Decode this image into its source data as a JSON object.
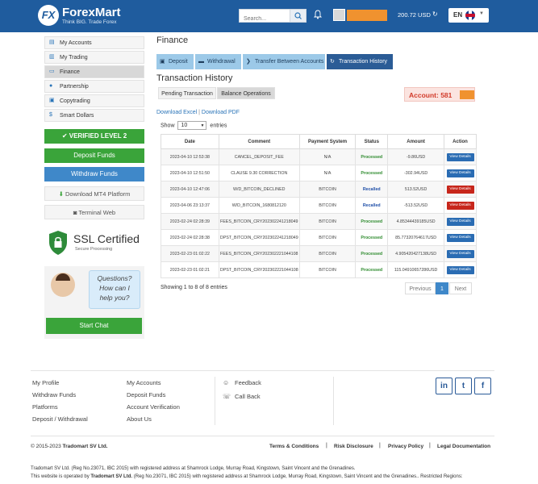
{
  "header": {
    "logo_name": "ForexMart",
    "logo_tagline": "Think BIG. Trade Forex",
    "search_placeholder": "Search...",
    "balance": "200.72 USD",
    "lang": "EN"
  },
  "sidebar": {
    "items": [
      {
        "label": "My Accounts",
        "icon": "document-icon"
      },
      {
        "label": "My Trading",
        "icon": "chart-icon"
      },
      {
        "label": "Finance",
        "icon": "card-icon"
      },
      {
        "label": "Partnership",
        "icon": "people-icon"
      },
      {
        "label": "Copytrading",
        "icon": "copy-icon"
      },
      {
        "label": "Smart Dollars",
        "icon": "dollar-icon"
      }
    ],
    "verified": "VERIFIED LEVEL 2",
    "deposit": "Deposit Funds",
    "withdraw": "Withdraw Funds",
    "mt4": "Download MT4 Platform",
    "terminal": "Terminal Web",
    "ssl_title": "SSL Certified",
    "ssl_sub": "Secure Processing",
    "chat_bubble": [
      "Questions?",
      "How can I",
      "help you?"
    ],
    "chat_button": "Start Chat"
  },
  "main": {
    "title": "Finance",
    "tabs": [
      "Deposit",
      "Withdrawal",
      "Transfer Between Accounts",
      "Transaction History"
    ],
    "section_title": "Transaction History",
    "subtabs": [
      "Pending Transaction",
      "Balance Operations"
    ],
    "account_label": "Account: 581",
    "download_excel": "Download Excel",
    "download_pdf": "Download PDF",
    "show_label": "Show",
    "show_value": "10",
    "entries_label": "entries",
    "table": {
      "headers": [
        "Date",
        "Comment",
        "Payment System",
        "Status",
        "Amount",
        "Action"
      ],
      "rows": [
        {
          "date": "2023-04-10 12:53:38",
          "comment": "CANCEL_DEPOSIT_FEE",
          "payment": "N/A",
          "status": "Processed",
          "amount": "-9.86USD",
          "action": "View Details",
          "action_color": "blue"
        },
        {
          "date": "2023-04-10 12:51:50",
          "comment": "CLAUSE 9.30 CORRECTION",
          "payment": "N/A",
          "status": "Processed",
          "amount": "-302.94USD",
          "action": "View Details",
          "action_color": "blue"
        },
        {
          "date": "2023-04-10 12:47:06",
          "comment": "W/D_BITCOIN_DECLINED",
          "payment": "BITCOIN",
          "status": "Recalled",
          "amount": "513.52USD",
          "action": "View Details",
          "action_color": "red"
        },
        {
          "date": "2023-04-06 23:13:37",
          "comment": "W/D_BITCOIN_1680812120",
          "payment": "BITCOIN",
          "status": "Recalled",
          "amount": "-513.52USD",
          "action": "View Details",
          "action_color": "red"
        },
        {
          "date": "2023-02-24 02:28:39",
          "comment": "FEES_BITCOIN_CRY202302241218049",
          "payment": "BITCOIN",
          "status": "Processed",
          "amount": "4.85344439185USD",
          "action": "View Details",
          "action_color": "blue"
        },
        {
          "date": "2023-02-24 02:28:38",
          "comment": "DPST_BITCOIN_CRY202302241218049",
          "payment": "BITCOIN",
          "status": "Processed",
          "amount": "85.77320764617USD",
          "action": "View Details",
          "action_color": "blue"
        },
        {
          "date": "2023-02-23 01:02:22",
          "comment": "FEES_BITCOIN_CRY202302221044108",
          "payment": "BITCOIN",
          "status": "Processed",
          "amount": "4.905420427138USD",
          "action": "View Details",
          "action_color": "blue"
        },
        {
          "date": "2023-02-23 01:02:21",
          "comment": "DPST_BITCOIN_CRY202302221044108",
          "payment": "BITCOIN",
          "status": "Processed",
          "amount": "115.04910657286USD",
          "action": "View Details",
          "action_color": "blue"
        }
      ]
    },
    "showing": "Showing 1 to 8 of 8 entries",
    "pager": {
      "previous": "Previous",
      "page": "1",
      "next": "Next"
    }
  },
  "footer": {
    "col1": [
      "My Profile",
      "Withdraw Funds",
      "Platforms",
      "Deposit / Withdrawal"
    ],
    "col2": [
      "My Accounts",
      "Deposit Funds",
      "Account Verification",
      "About Us"
    ],
    "col3": [
      "Feedback",
      "Call Back"
    ],
    "social": [
      "in",
      "t",
      "f"
    ],
    "copyright_year": "© 2015-2023",
    "copyright_name": "Tradomart SV Ltd.",
    "legal": [
      "Terms & Conditions",
      "Risk Disclosure",
      "Privacy Policy",
      "Legal Documentation"
    ],
    "legal_text_1": "Tradomart SV Ltd. (Reg No.23071, IBC 2015) with registered address at Shamrock Lodge, Murray Road, Kingstown, Saint Vincent and the Grenadines.",
    "legal_text_2_prefix": "This website is operated by",
    "legal_text_2_bold": "Tradomart SV Ltd.",
    "legal_text_2_suffix": "(Reg No.23071, IBC 2015) with registered address at Shamrock Lodge, Murray Road, Kingstown, Saint Vincent and the Grenadines.. Restricted Regions:"
  },
  "colors": {
    "header_bg": "#1f5c9e",
    "green": "#3aa43a",
    "blue_btn": "#3f88c9",
    "tab_active": "#2b5c96",
    "tab_inactive": "#9cc9e8",
    "account_red": "#d23b2a",
    "mask_orange": "#f0922f"
  }
}
